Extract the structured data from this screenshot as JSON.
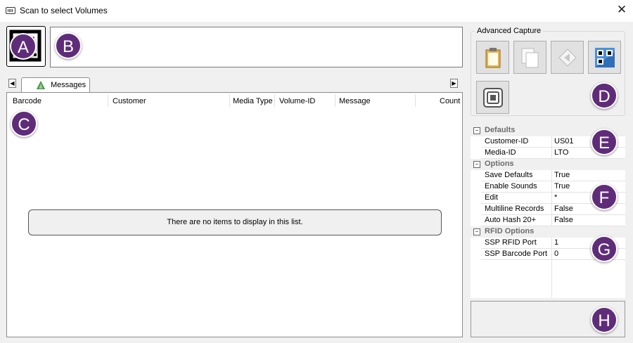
{
  "window": {
    "title": "Scan to select Volumes"
  },
  "tabs": {
    "messages_label": "Messages"
  },
  "list": {
    "columns": [
      "Barcode",
      "Customer",
      "Media Type",
      "Volume-ID",
      "Message",
      "Count"
    ],
    "empty_text": "There are no items to display in this list."
  },
  "advanced_capture": {
    "title": "Advanced Capture"
  },
  "properties": {
    "defaults": {
      "label": "Defaults",
      "rows": [
        {
          "key": "Customer-ID",
          "value": "US01"
        },
        {
          "key": "Media-ID",
          "value": "LTO"
        }
      ]
    },
    "options": {
      "label": "Options",
      "rows": [
        {
          "key": "Save Defaults",
          "value": "True"
        },
        {
          "key": "Enable Sounds",
          "value": "True"
        },
        {
          "key": "Edit",
          "value": "*"
        },
        {
          "key": "Multiline Records",
          "value": "False"
        },
        {
          "key": "Auto Hash 20+",
          "value": "False"
        }
      ]
    },
    "rfid": {
      "label": "RFID Options",
      "rows": [
        {
          "key": "SSP RFID Port",
          "value": "1"
        },
        {
          "key": "SSP Barcode Port",
          "value": "0"
        }
      ]
    }
  },
  "callouts": {
    "a": "A",
    "b": "B",
    "c": "C",
    "d": "D",
    "e": "E",
    "f": "F",
    "g": "G",
    "h": "H"
  },
  "colors": {
    "callout": "#5f2c79",
    "window_bg": "#f0f0f0"
  }
}
